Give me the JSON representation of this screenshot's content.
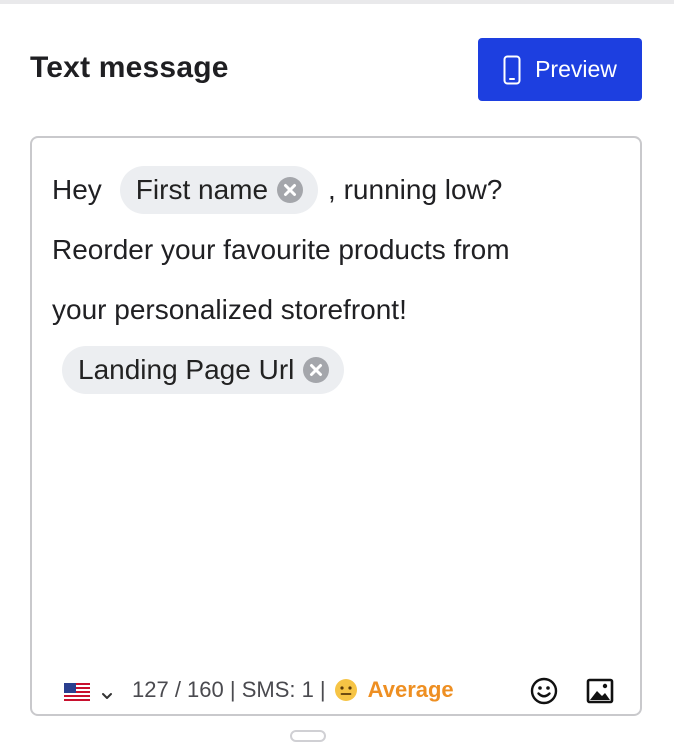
{
  "panel": {
    "title": "Text message"
  },
  "preview_button": {
    "label": "Preview",
    "icon": "phone-icon",
    "color": "#1d3fe0"
  },
  "message": {
    "segments": {
      "greeting": "Hey",
      "token_first_name": "First name",
      "after_token": ", running low?",
      "line2": "Reorder your favourite products from",
      "line3": "your personalized storefront!",
      "token_landing_url": "Landing Page Url"
    }
  },
  "footer": {
    "country_flag": "us-flag-icon",
    "counter": "127 / 160 | SMS: 1 | ",
    "rating_label": "Average",
    "rating_color": "#ee8f22",
    "emoji_button_icon": "smiley-icon",
    "image_button_icon": "image-icon"
  }
}
